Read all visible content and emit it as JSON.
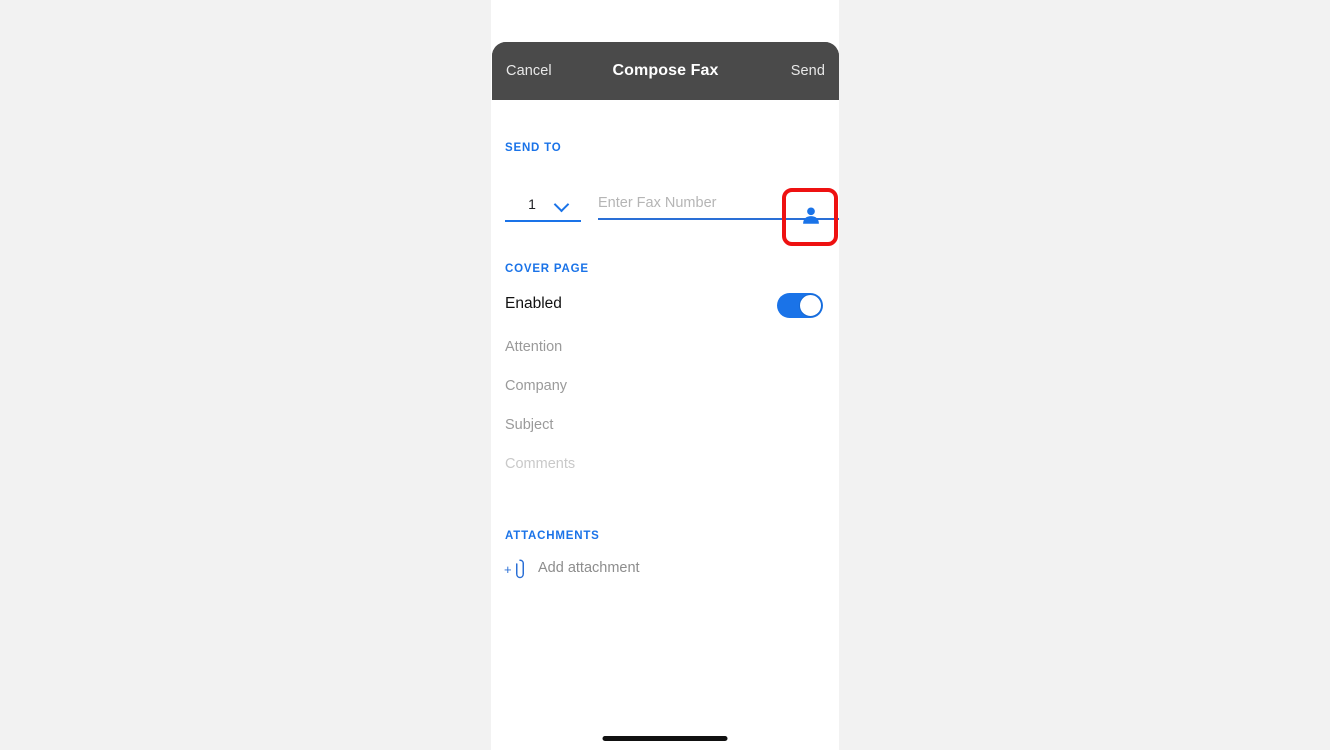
{
  "app": {
    "background_color": "#f2f2f2",
    "accent_color": "#1a73e8",
    "highlight_color": "#ee1111"
  },
  "navbar": {
    "cancel_label": "Cancel",
    "title": "Compose Fax",
    "send_label": "Send"
  },
  "send_to": {
    "section_label": "SEND TO",
    "count_value": "1",
    "count_chevron_icon": "chevron-down-icon",
    "fax_placeholder": "Enter Fax Number",
    "fax_value": "",
    "contact_icon": "contact-person-icon"
  },
  "cover_page": {
    "section_label": "COVER PAGE",
    "enabled_label": "Enabled",
    "enabled_state": "on",
    "fields": [
      {
        "placeholder": "Attention",
        "tone": "dark"
      },
      {
        "placeholder": "Company",
        "tone": "dark"
      },
      {
        "placeholder": "Subject",
        "tone": "dark"
      },
      {
        "placeholder": "Comments",
        "tone": "light"
      }
    ]
  },
  "attachments": {
    "section_label": "ATTACHMENTS",
    "add_plus": "+",
    "clip_icon": "paperclip-icon",
    "add_label": "Add attachment"
  }
}
